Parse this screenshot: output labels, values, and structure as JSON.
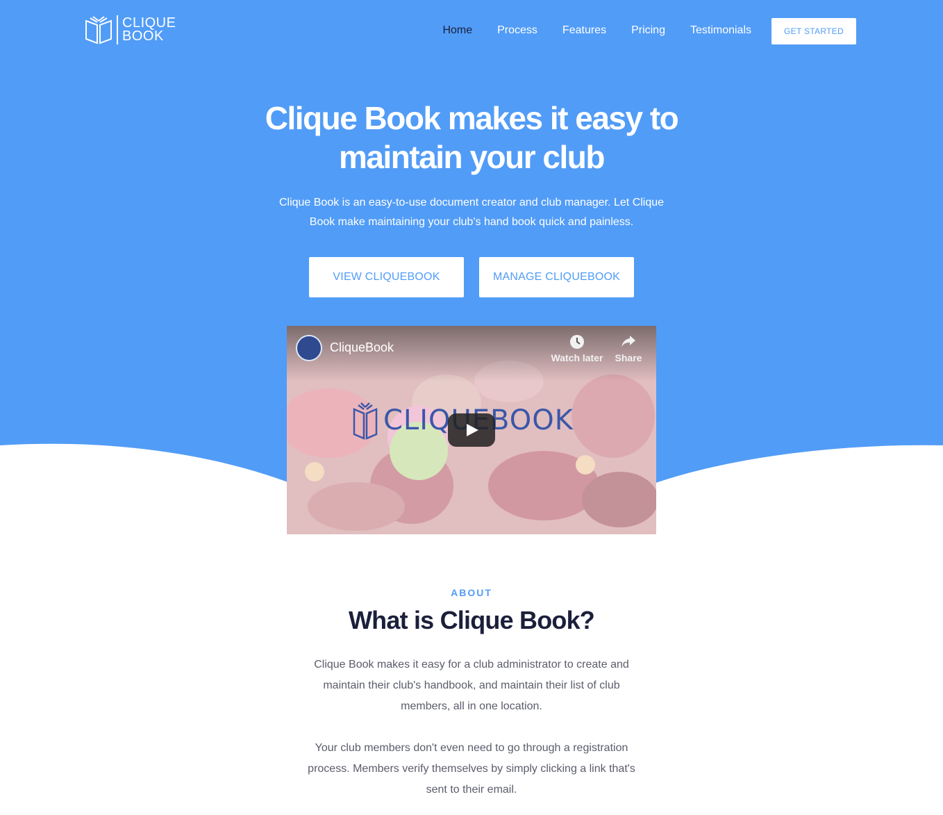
{
  "brand": {
    "name_line1": "CLIQUE",
    "name_line2": "BOOK",
    "color": "#519cf7"
  },
  "nav": {
    "items": [
      {
        "label": "Home",
        "active": true
      },
      {
        "label": "Process",
        "active": false
      },
      {
        "label": "Features",
        "active": false
      },
      {
        "label": "Pricing",
        "active": false
      },
      {
        "label": "Testimonials",
        "active": false
      }
    ],
    "cta_label": "GET STARTED"
  },
  "hero": {
    "title": "Clique Book makes it easy to maintain your club",
    "subtitle": "Clique Book is an easy-to-use document creator and club manager. Let Clique Book make maintaining your club's hand book quick and painless.",
    "view_button": "VIEW CLIQUEBOOK",
    "manage_button": "MANAGE CLIQUEBOOK"
  },
  "video": {
    "channel_name": "CliqueBook",
    "watch_later_label": "Watch later",
    "share_label": "Share",
    "logo_text": "CLIQUEBOOK"
  },
  "about": {
    "eyebrow": "ABOUT",
    "title": "What is Clique Book?",
    "paragraph1": "Clique Book makes it easy for a club administrator to create and maintain their club's handbook, and maintain their list of club members, all in one location.",
    "paragraph2": "Your club members don't even need to go through a registration process. Members verify themselves by simply clicking a link that's sent to their email."
  }
}
